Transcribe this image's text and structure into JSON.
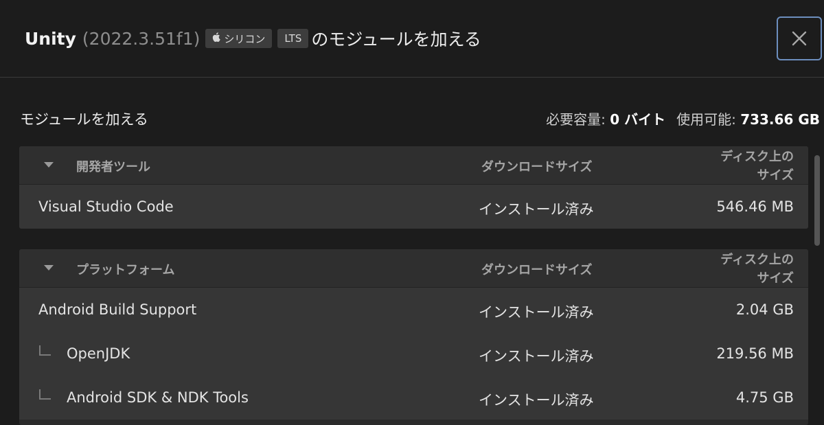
{
  "header": {
    "app_name": "Unity",
    "version": "(2022.3.51f1)",
    "badge_silicon": "シリコン",
    "badge_silicon_icon": "apple-icon",
    "badge_lts": "LTS",
    "title_suffix": "のモジュールを加える",
    "close_icon": "close-icon"
  },
  "summary": {
    "title": "モジュールを加える",
    "required_label": "必要容量:",
    "required_value": "0 バイト",
    "available_label": "使用可能:",
    "available_value": "733.66 GB"
  },
  "groups": [
    {
      "name": "開発者ツール",
      "col_download": "ダウンロードサイズ",
      "col_disk_line1": "ディスク上の",
      "col_disk_line2": "サイズ",
      "rows": [
        {
          "name": "Visual Studio Code",
          "status": "インストール済み",
          "size": "546.46 MB"
        }
      ]
    },
    {
      "name": "プラットフォーム",
      "col_download": "ダウンロードサイズ",
      "col_disk_line1": "ディスク上の",
      "col_disk_line2": "サイズ",
      "rows": [
        {
          "name": "Android Build Support",
          "status": "インストール済み",
          "size": "2.04 GB"
        },
        {
          "name": "OpenJDK",
          "status": "インストール済み",
          "size": "219.56 MB"
        },
        {
          "name": "Android SDK & NDK Tools",
          "status": "インストール済み",
          "size": "4.75 GB"
        }
      ]
    }
  ],
  "colors": {
    "background": "#1c1c1c",
    "group_bg": "#2b2b2b",
    "row_bg": "#363636",
    "close_border": "#6d8fbf"
  }
}
